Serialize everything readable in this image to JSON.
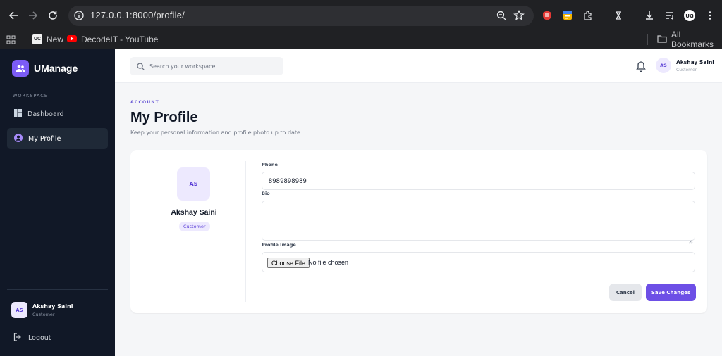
{
  "browser": {
    "url": "127.0.0.1:8000/profile/",
    "bookmarks": [
      {
        "label": "New",
        "icon": "uc-icon"
      },
      {
        "label": "DecodeIT - YouTube",
        "icon": "youtube-icon"
      }
    ],
    "all_bookmarks_label": "All Bookmarks"
  },
  "app": {
    "name": "UManage",
    "brand_color": "#7c5cf6"
  },
  "sidebar": {
    "section_label": "WORKSPACE",
    "items": [
      {
        "label": "Dashboard",
        "icon": "dashboard-icon",
        "active": false
      },
      {
        "label": "My Profile",
        "icon": "user-circle-icon",
        "active": true
      }
    ],
    "user": {
      "initials": "AS",
      "name": "Akshay Saini",
      "role": "Customer"
    },
    "logout_label": "Logout"
  },
  "topbar": {
    "search_placeholder": "Search your workspace...",
    "user": {
      "initials": "AS",
      "name": "Akshay Saini",
      "role": "Customer"
    }
  },
  "page": {
    "eyebrow": "ACCOUNT",
    "title": "My Profile",
    "subtitle": "Keep your personal information and profile photo up to date."
  },
  "profile": {
    "initials": "AS",
    "name": "Akshay Saini",
    "role": "Customer"
  },
  "form": {
    "phone_label": "Phone",
    "phone_value": "8989898989",
    "bio_label": "Bio",
    "bio_value": "",
    "image_label": "Profile Image",
    "choose_file_label": "Choose File",
    "file_status": "No file chosen",
    "cancel_label": "Cancel",
    "save_label": "Save Changes"
  }
}
